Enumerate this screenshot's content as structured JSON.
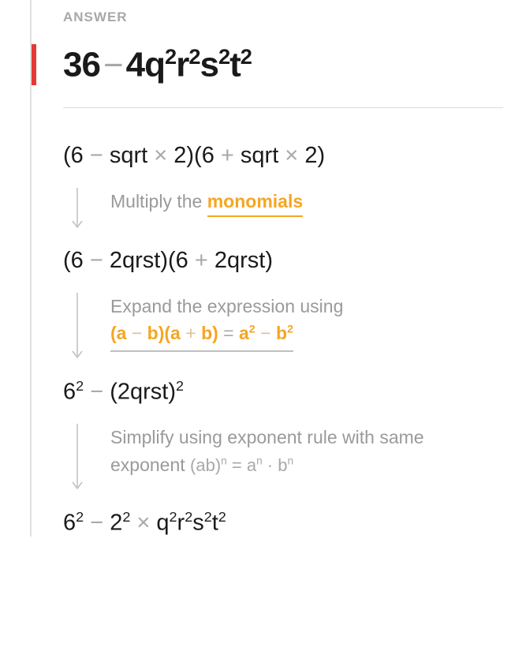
{
  "section_label": "ANSWER",
  "answer": {
    "p1": "36",
    "minus": "−",
    "p2": "4q",
    "e2": "2",
    "p3": "r",
    "e3": "2",
    "p4": "s",
    "e4": "2",
    "p5": "t",
    "e5": "2"
  },
  "steps": [
    {
      "expr": {
        "a1": "(6",
        "o1": " − ",
        "a2": "sqrt",
        "o2": " × ",
        "a3": "2)(6",
        "o3": " + ",
        "a4": "sqrt",
        "o4": " × ",
        "a5": "2)"
      },
      "expl": {
        "text": "Multiply the ",
        "link": "monomials"
      }
    },
    {
      "expr": {
        "a1": "(6",
        "o1": " − ",
        "a2": "2qrst)(6",
        "o3": " + ",
        "a4": "2qrst)"
      },
      "expl": {
        "text": "Expand the expression using",
        "formula": {
          "fa1": "(a",
          "fo1": " − ",
          "fa2": "b)(a",
          "fo2": " + ",
          "fa3": "b)",
          "feq": " = ",
          "fa4": "a",
          "fe4": "2",
          "fo3": " − ",
          "fa5": "b",
          "fe5": "2"
        }
      }
    },
    {
      "expr": {
        "a1": "6",
        "e1": "2",
        "o1": " − ",
        "a2": "(2qrst)",
        "e2": "2"
      },
      "expl": {
        "text1": "Simplify using exponent rule with same exponent ",
        "formula": {
          "f1": "(ab)",
          "fe1": "n",
          "feq": " = ",
          "f2": "a",
          "fe2": "n",
          "fdot": " · ",
          "f3": "b",
          "fe3": "n"
        }
      }
    },
    {
      "expr": {
        "a1": "6",
        "e1": "2",
        "o1": " − ",
        "a2": "2",
        "e2": "2",
        "o2": " × ",
        "a3": "q",
        "e3": "2",
        "a4": "r",
        "e4": "2",
        "a5": "s",
        "e5": "2",
        "a6": "t",
        "e6": "2"
      }
    }
  ]
}
